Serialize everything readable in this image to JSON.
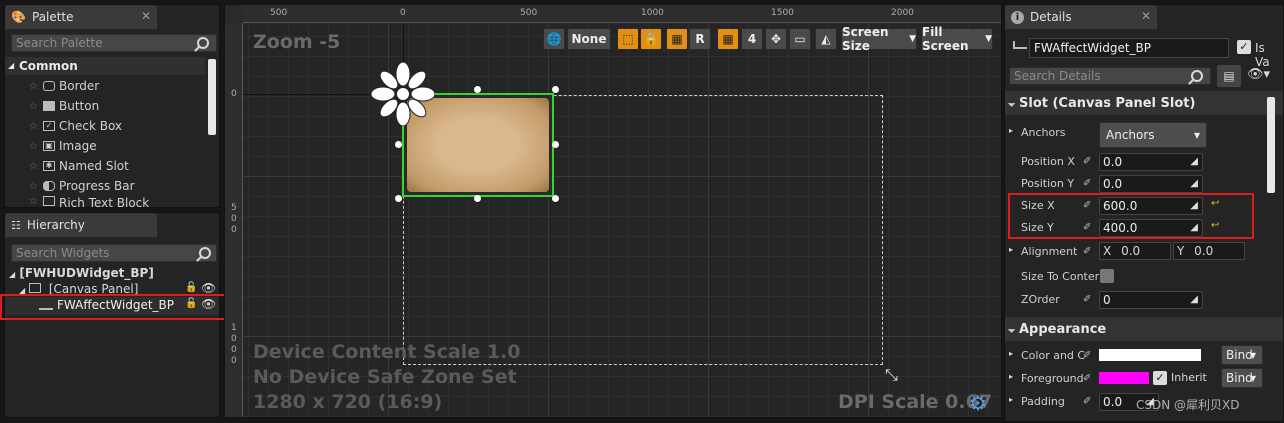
{
  "palette": {
    "tab_title": "Palette",
    "search_placeholder": "Search Palette",
    "category": "Common",
    "items": [
      "Border",
      "Button",
      "Check Box",
      "Image",
      "Named Slot",
      "Progress Bar",
      "Rich Text Block"
    ]
  },
  "hierarchy": {
    "tab_title": "Hierarchy",
    "search_placeholder": "Search Widgets",
    "root": "[FWHUDWidget_BP]",
    "canvas": "[Canvas Panel]",
    "widget": "FWAffectWidget_BP"
  },
  "designer": {
    "zoom": "Zoom -5",
    "ruler_top": [
      "500",
      "0",
      "500",
      "1000",
      "1500",
      "2000"
    ],
    "ruler_left": [
      "0",
      "5",
      "0",
      "0",
      "1",
      "0",
      "0",
      "0"
    ],
    "toolbar": {
      "none_label": "None",
      "r_label": "R",
      "grid_value": "4",
      "screen_size": "Screen Size",
      "fill_screen": "Fill Screen"
    },
    "device_content_scale": "Device Content Scale 1.0",
    "safe_zone": "No Device Safe Zone Set",
    "resolution": "1280 x 720 (16:9)",
    "dpi_scale": "DPI Scale 0.67"
  },
  "details": {
    "tab_title": "Details",
    "widget_name": "FWAffectWidget_BP",
    "is_variable_label": "Is Va",
    "is_variable_checked": true,
    "search_placeholder": "Search Details",
    "slot_section": "Slot (Canvas Panel Slot)",
    "anchors_label": "Anchors",
    "anchors_value": "Anchors",
    "position_x_label": "Position X",
    "position_x": "0.0",
    "position_y_label": "Position Y",
    "position_y": "0.0",
    "size_x_label": "Size X",
    "size_x": "600.0",
    "size_y_label": "Size Y",
    "size_y": "400.0",
    "alignment_label": "Alignment",
    "alignment_x_label": "X",
    "alignment_x": "0.0",
    "alignment_y_label": "Y",
    "alignment_y": "0.0",
    "size_to_content_label": "Size To Conter",
    "zorder_label": "ZOrder",
    "zorder": "0",
    "appearance_section": "Appearance",
    "color_label": "Color and C",
    "foreground_label": "Foreground",
    "inherit_label": "Inherit",
    "bind_label": "Bind",
    "padding_label": "Padding",
    "padding": "0.0",
    "color_swatch": "#ffffff",
    "foreground_swatch": "#ff00ff"
  },
  "watermark": "CSDN @犀利贝XD"
}
